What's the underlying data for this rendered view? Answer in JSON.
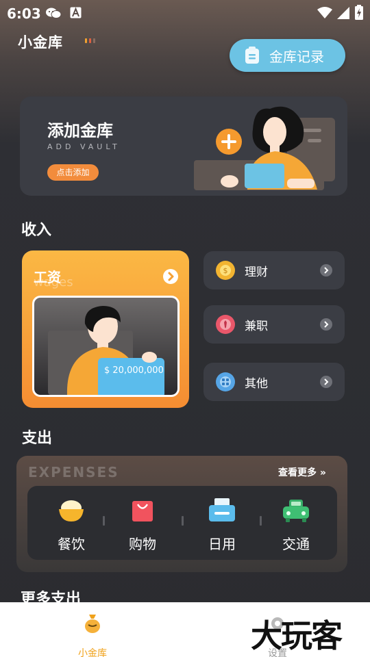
{
  "status_bar": {
    "time": "6:03"
  },
  "header": {
    "app_title": "小金库",
    "record_button": "金库记录"
  },
  "add_vault": {
    "title": "添加金库",
    "subtitle": "ADD VAULT",
    "button": "点击添加"
  },
  "income": {
    "heading": "收入",
    "wages": {
      "title": "工资",
      "subtitle": "wages",
      "amount": "$ 20,000,000"
    },
    "items": [
      {
        "label": "理财",
        "icon": "coin-icon",
        "color": "#f2b431"
      },
      {
        "label": "兼职",
        "icon": "tie-icon",
        "color": "#e9576a"
      },
      {
        "label": "其他",
        "icon": "grid-icon",
        "color": "#56a5e6"
      }
    ]
  },
  "expense": {
    "heading": "支出",
    "watermark": "EXPENSES",
    "more_link": "查看更多",
    "items": [
      {
        "label": "餐饮",
        "icon": "rice-bowl-icon"
      },
      {
        "label": "购物",
        "icon": "shopping-bag-icon"
      },
      {
        "label": "日用",
        "icon": "printer-icon"
      },
      {
        "label": "交通",
        "icon": "car-icon"
      }
    ]
  },
  "more_expense": {
    "heading": "更多支出"
  },
  "bottom_nav": {
    "home": "小金库",
    "settings": "设置"
  },
  "watermark_logo": "大玩客",
  "colors": {
    "accent_orange": "#f28c3c",
    "accent_blue": "#6cc3e4",
    "card_bg": "#3b3d44"
  }
}
